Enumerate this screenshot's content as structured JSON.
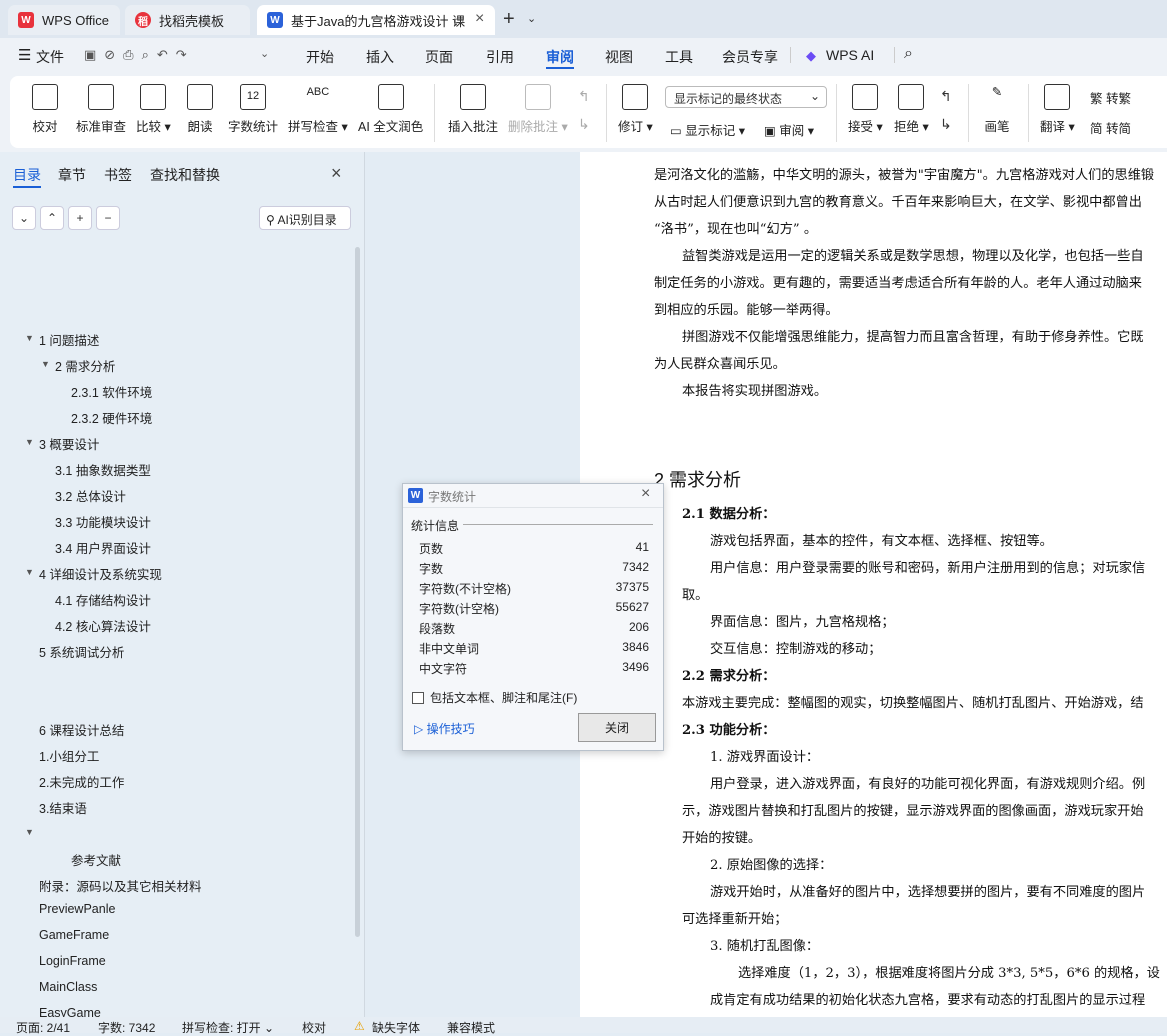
{
  "tabs": [
    {
      "label": "WPS Office",
      "icon": "W"
    },
    {
      "label": "找稻壳模板",
      "icon": "稻"
    },
    {
      "label": "基于Java的九宫格游戏设计 课",
      "icon": "W"
    }
  ],
  "menu": [
    "文件",
    "开始",
    "插入",
    "页面",
    "引用",
    "审阅",
    "视图",
    "工具",
    "会员专享",
    "WPS AI"
  ],
  "ribbon": {
    "buttons": [
      "校对",
      "标准审查",
      "比较",
      "朗读",
      "字数统计",
      "拼写检查",
      "AI 全文润色",
      "插入批注",
      "删除批注",
      "修订",
      "画笔",
      "翻译"
    ],
    "dropdown_value": "显示标记的最终状态",
    "small": [
      "显示标记",
      "审阅",
      "接受",
      "拒绝",
      "转繁",
      "转简"
    ],
    "icon_text": {
      "count": "12",
      "spell": "ABC"
    }
  },
  "nav": {
    "tabs": [
      "目录",
      "章节",
      "书签",
      "查找和替换"
    ],
    "ai_button": "AI识别目录",
    "toc": [
      "1 问题描述",
      "2 需求分析",
      "2.3.1 软件环境",
      "2.3.2 硬件环境",
      "3 概要设计",
      "3.1 抽象数据类型",
      "3.2 总体设计",
      "3.3 功能模块设计",
      "3.4 用户界面设计",
      "4 详细设计及系统实现",
      "4.1 存储结构设计",
      "4.2 核心算法设计",
      "5 系统调试分析",
      "6 课程设计总结",
      "1.小组分工",
      "2.未完成的工作",
      "3.结束语",
      "参考文献",
      "附录：源码以及其它相关材料",
      "PreviewPanle",
      "GameFrame",
      "LoginFrame",
      "MainClass",
      "EasyGame"
    ]
  },
  "doc": {
    "lines": [
      "是河洛文化的滥觞，中华文明的源头，被誉为\"宇宙魔方\"。九宫格游戏对人们的思维锻",
      "从古时起人们便意识到九宫的教育意义。千百年来影响巨大，在文学、影视中都曾出",
      "“洛书”，现在也叫“幻方” 。",
      "益智类游戏是运用一定的逻辑关系或是数学思想，物理以及化学，也包括一些自",
      "制定任务的小游戏。更有趣的，需要适当考虑适合所有年龄的人。老年人通过动脑来",
      "到相应的乐园。能够一举两得。",
      "拼图游戏不仅能增强思维能力，提高智力而且富含哲理，有助于修身养性。它既",
      "为人民群众喜闻乐见。",
      "本报告将实现拼图游戏。",
      "2 需求分析",
      "2.1 数据分析：",
      "游戏包括界面，基本的控件，有文本框、选择框、按钮等。",
      "用户信息：用户登录需要的账号和密码，新用户注册用到的信息；对玩家信",
      "取。",
      "界面信息：图片，九宫格规格；",
      "交互信息：控制游戏的移动；",
      "2.2 需求分析：",
      "本游戏主要完成：整幅图的观实，切换整幅图片、随机打乱图片、开始游戏，结",
      "2.3 功能分析：",
      "1. 游戏界面设计：",
      "用户登录，进入游戏界面，有良好的功能可视化界面，有游戏规则介绍。例",
      "示，游戏图片替换和打乱图片的按键，显示游戏界面的图像画面，游戏玩家开始",
      "开始的按键。",
      "2. 原始图像的选择：",
      "游戏开始时，从准备好的图片中，选择想要拼的图片，要有不同难度的图片",
      "可选择重新开始；",
      "3. 随机打乱图像：",
      "选择难度（1，2，3），根据难度将图片分成 3*3, 5*5，6*6 的规格，设",
      "成肯定有成功结果的初始化状态九宫格，要求有动态的打乱图片的显示过程"
    ]
  },
  "dialog": {
    "title": "字数统计",
    "section": "统计信息",
    "rows": [
      {
        "label": "页数",
        "value": "41"
      },
      {
        "label": "字数",
        "value": "7342"
      },
      {
        "label": "字符数(不计空格)",
        "value": "37375"
      },
      {
        "label": "字符数(计空格)",
        "value": "55627"
      },
      {
        "label": "段落数",
        "value": "206"
      },
      {
        "label": "非中文单词",
        "value": "3846"
      },
      {
        "label": "中文字符",
        "value": "3496"
      }
    ],
    "checkbox": "包括文本框、脚注和尾注(F)",
    "tips": "操作技巧",
    "close": "关闭"
  },
  "status": {
    "page": "页面: 2/41",
    "words": "字数: 7342",
    "spell": "拼写检查: 打开",
    "proof": "校对",
    "font": "缺失字体",
    "compat": "兼容模式"
  },
  "colors": {
    "accent": "#1a5fd6",
    "wps_red": "#e8323c",
    "doc_blue": "#2b62d9"
  }
}
